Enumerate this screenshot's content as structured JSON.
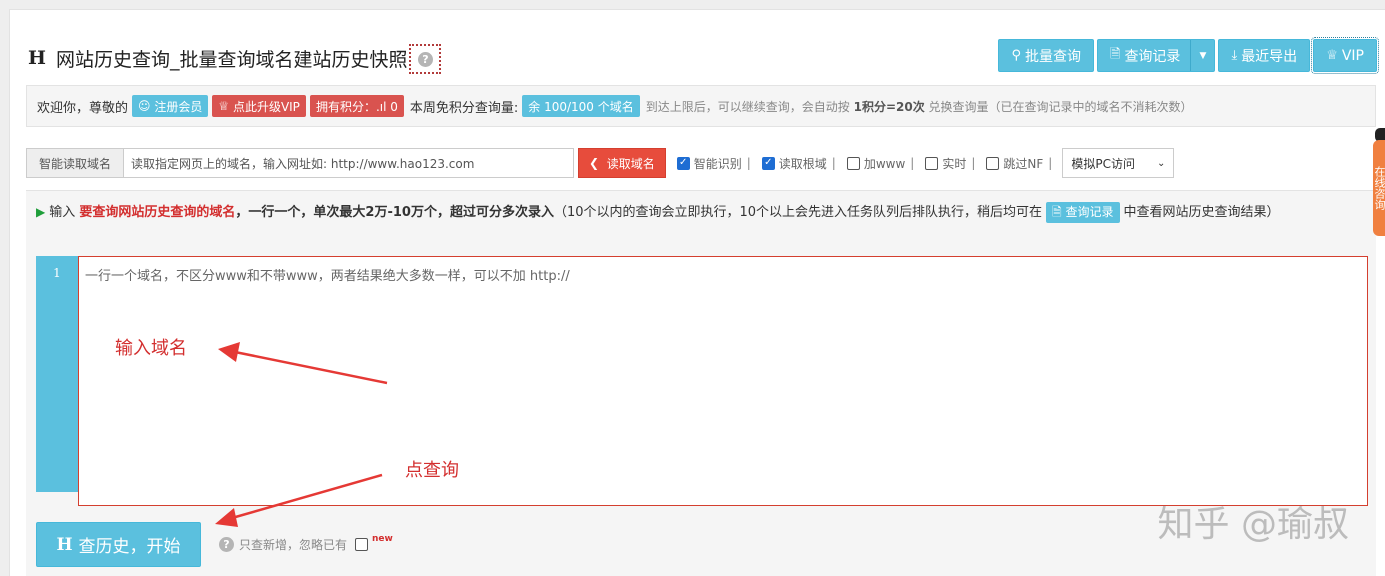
{
  "header": {
    "logo": "H",
    "title": "网站历史查询_批量查询域名建站历史快照",
    "help": "?"
  },
  "toolbar": {
    "batch_query": "批量查询",
    "query_records": "查询记录",
    "recent_export": "最近导出",
    "vip": "VIP"
  },
  "welcome": {
    "greeting": "欢迎你，尊敬的",
    "register": "注册会员",
    "upgrade": "点此升级VIP",
    "points": "拥有积分：.ıl 0",
    "weekly_label": "本周免积分查询量:",
    "quota": "余 100/100 个域名",
    "note": "到达上限后，可以继续查询，会自动按",
    "rate": "1积分=20次",
    "note2": "兑换查询量（已在查询记录中的域名不消耗次数）"
  },
  "reader": {
    "addon": "智能读取域名",
    "input_placeholder": "读取指定网页上的域名，输入网址如: http://www.hao123.com",
    "read_button": "读取域名",
    "options": [
      {
        "label": "智能识别",
        "checked": true
      },
      {
        "label": "读取根域",
        "checked": true
      },
      {
        "label": "加www",
        "checked": false
      },
      {
        "label": "实时",
        "checked": false
      },
      {
        "label": "跳过NF",
        "checked": false
      }
    ],
    "mode_select": "模拟PC访问"
  },
  "instructions": {
    "prefix": "输入",
    "highlight": "要查询网站历史查询的域名",
    "rule": "，一行一个，单次最大2万-10万个，超过可分多次录入",
    "detail": "（10个以内的查询会立即执行，10个以上会先进入任务队列后排队执行，稍后均可在",
    "records_link": "查询记录",
    "suffix": "中查看网站历史查询结果）"
  },
  "editor": {
    "line_number": "1",
    "placeholder": "一行一个域名，不区分www和不带www，两者结果绝大多数一样，可以不加 http://"
  },
  "annotations": {
    "input_domain": "输入域名",
    "click_query": "点查询"
  },
  "start": {
    "logo": "H",
    "label": "查历史，开始"
  },
  "only_new": {
    "label": "只查新增，忽略已有",
    "new_badge": "new"
  },
  "side_tab": "在线咨询",
  "watermark": "知乎 @瑜叔"
}
